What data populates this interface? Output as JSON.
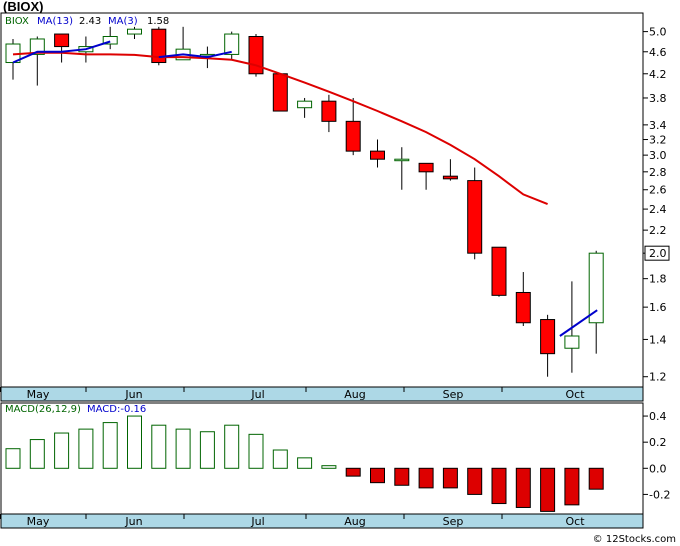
{
  "title": "(BIOX)",
  "watermark": "© 12Stocks.com",
  "colors": {
    "up_candle": "#006400",
    "down_candle": "#ff0000",
    "ma13_line": "#dd0000",
    "ma3_line": "#0000cc",
    "axis_band": "#add8e6",
    "macd_pos": "#006400",
    "macd_neg": "#dd0000"
  },
  "chart_data": [
    {
      "type": "candlestick",
      "legend": [
        {
          "text": "BIOX",
          "color": "#006400"
        },
        {
          "text": "MA(13)",
          "color": "#0000cc"
        },
        {
          "text": "2.43",
          "color": "#000000"
        },
        {
          "text": "MA(3)",
          "color": "#0000cc"
        },
        {
          "text": "1.58",
          "color": "#000000"
        }
      ],
      "current_price": "2.0",
      "y_scale": "log",
      "ylim": [
        1.15,
        5.4
      ],
      "yticks": [
        "5.0",
        "4.6",
        "4.2",
        "3.8",
        "3.4",
        "3.2",
        "3.0",
        "2.8",
        "2.6",
        "2.4",
        "2.2",
        "2.0",
        "1.8",
        "1.6",
        "1.4",
        "1.2"
      ],
      "x_month_labels": [
        "May",
        "Jun",
        "Jul",
        "Aug",
        "Sep",
        "Oct"
      ],
      "candles": [
        {
          "o": 4.4,
          "c": 4.75,
          "h": 4.85,
          "l": 4.1
        },
        {
          "o": 4.55,
          "c": 4.85,
          "h": 4.9,
          "l": 4.0
        },
        {
          "o": 4.95,
          "c": 4.7,
          "h": 4.95,
          "l": 4.4
        },
        {
          "o": 4.6,
          "c": 4.7,
          "h": 4.9,
          "l": 4.4
        },
        {
          "o": 4.75,
          "c": 4.9,
          "h": 5.1,
          "l": 4.65
        },
        {
          "o": 4.95,
          "c": 5.05,
          "h": 5.1,
          "l": 4.85
        },
        {
          "o": 5.05,
          "c": 4.4,
          "h": 5.1,
          "l": 4.35
        },
        {
          "o": 4.45,
          "c": 4.65,
          "h": 5.1,
          "l": 4.45
        },
        {
          "o": 4.55,
          "c": 4.55,
          "h": 4.7,
          "l": 4.3
        },
        {
          "o": 4.55,
          "c": 4.95,
          "h": 5.0,
          "l": 4.45
        },
        {
          "o": 4.9,
          "c": 4.2,
          "h": 4.95,
          "l": 4.15
        },
        {
          "o": 4.2,
          "c": 3.6,
          "h": 4.2,
          "l": 3.6
        },
        {
          "o": 3.65,
          "c": 3.75,
          "h": 3.8,
          "l": 3.5
        },
        {
          "o": 3.75,
          "c": 3.45,
          "h": 3.85,
          "l": 3.3
        },
        {
          "o": 3.45,
          "c": 3.05,
          "h": 3.8,
          "l": 3.0
        },
        {
          "o": 3.05,
          "c": 2.95,
          "h": 3.2,
          "l": 2.85
        },
        {
          "o": 2.95,
          "c": 2.95,
          "h": 3.1,
          "l": 2.6
        },
        {
          "o": 2.9,
          "c": 2.8,
          "h": 2.9,
          "l": 2.6
        },
        {
          "o": 2.75,
          "c": 2.72,
          "h": 2.95,
          "l": 2.7
        },
        {
          "o": 2.7,
          "c": 2.0,
          "h": 2.85,
          "l": 1.95
        },
        {
          "o": 2.05,
          "c": 1.68,
          "h": 2.05,
          "l": 1.67
        },
        {
          "o": 1.7,
          "c": 1.5,
          "h": 1.85,
          "l": 1.48
        },
        {
          "o": 1.52,
          "c": 1.32,
          "h": 1.55,
          "l": 1.2
        },
        {
          "o": 1.35,
          "c": 1.42,
          "h": 1.78,
          "l": 1.22
        },
        {
          "o": 1.5,
          "c": 2.0,
          "h": 2.02,
          "l": 1.32
        }
      ],
      "ma13": [
        4.55,
        4.58,
        4.58,
        4.55,
        4.55,
        4.54,
        4.5,
        4.5,
        4.48,
        4.45,
        4.35,
        4.2,
        4.05,
        3.9,
        3.75,
        3.6,
        3.45,
        3.3,
        3.13,
        2.95,
        2.75,
        2.55,
        2.45
      ],
      "ma3": [
        4.4,
        4.6,
        4.6,
        4.65,
        4.8,
        null,
        4.5,
        4.55,
        4.5,
        4.6,
        null,
        null,
        null,
        null,
        null,
        null,
        null,
        null,
        null,
        null,
        null,
        null,
        1.58
      ]
    },
    {
      "type": "bar",
      "legend": [
        {
          "text": "MACD(26,12,9)",
          "color": "#006400"
        },
        {
          "text": "MACD:-0.16",
          "color": "#0000cc"
        }
      ],
      "ylim": [
        -0.35,
        0.5
      ],
      "yticks": [
        "0.4",
        "0.2",
        "0.0",
        "-0.2"
      ],
      "x_month_labels": [
        "May",
        "Jun",
        "Jul",
        "Aug",
        "Sep",
        "Oct"
      ],
      "values": [
        0.15,
        0.22,
        0.27,
        0.3,
        0.35,
        0.4,
        0.33,
        0.3,
        0.28,
        0.33,
        0.26,
        0.14,
        0.08,
        0.02,
        -0.06,
        -0.11,
        -0.13,
        -0.15,
        -0.15,
        -0.2,
        -0.27,
        -0.3,
        -0.33,
        -0.28,
        -0.16
      ]
    }
  ]
}
